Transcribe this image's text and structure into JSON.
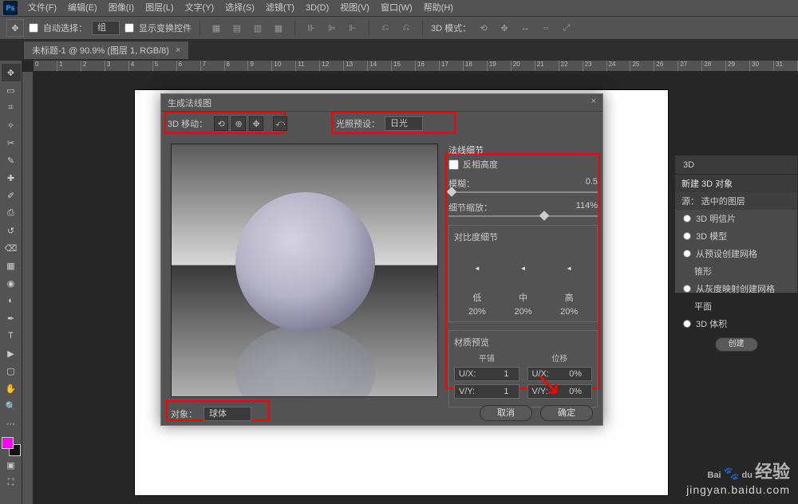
{
  "menubar": {
    "items": [
      "文件(F)",
      "编辑(E)",
      "图像(I)",
      "图层(L)",
      "文字(Y)",
      "选择(S)",
      "滤镜(T)",
      "3D(D)",
      "视图(V)",
      "窗口(W)",
      "帮助(H)"
    ]
  },
  "optbar": {
    "auto_select": "自动选择：",
    "auto_select_value": "组",
    "show_transform": "显示变换控件",
    "mode_3d": "3D 模式："
  },
  "tab": {
    "title": "未标题-1 @ 90.9% (图层 1, RGB/8)",
    "close": "×"
  },
  "ruler": {
    "marks": [
      "0",
      "1",
      "2",
      "3",
      "4",
      "5",
      "6",
      "7",
      "8",
      "9",
      "10",
      "11",
      "12",
      "13",
      "14",
      "15",
      "16",
      "17",
      "18",
      "19",
      "20",
      "21",
      "22",
      "23",
      "24",
      "25",
      "26",
      "27",
      "28",
      "29",
      "30",
      "31"
    ]
  },
  "dialog": {
    "title": "生成法线图",
    "close": "×",
    "move3d_label": "3D 移动：",
    "light_label": "光照预设：",
    "light_value": "日光",
    "normals_header": "法线细节",
    "invert_height": "反相高度",
    "blur_label": "模糊：",
    "blur_value": "0.5",
    "detail_scale_label": "细节缩放：",
    "detail_scale_value": "114%",
    "contrast_title": "对比度细节",
    "contrast_labels": {
      "low": "低",
      "mid": "中",
      "high": "高"
    },
    "contrast_values": {
      "low": "20%",
      "mid": "20%",
      "high": "20%"
    },
    "arrow_left": "◄",
    "arrow_right": "►",
    "mat_title": "材质预览",
    "mat_tile": "平铺",
    "mat_offset": "位移",
    "mat_ux": "U/X:",
    "mat_vy": "V/Y:",
    "mat_ux_tile": "1",
    "mat_vy_tile": "1",
    "mat_ux_off": "0%",
    "mat_vy_off": "0%",
    "object_label": "对象：",
    "object_value": "球体",
    "cancel": "取消",
    "ok": "确定"
  },
  "panel3d": {
    "tab": "3D",
    "new_obj": "新建 3D 对象",
    "source": "源：",
    "source_value": "选中的图层",
    "opts": [
      "3D 明信片",
      "3D 模型",
      "从预设创建网格",
      "锥形",
      "从灰度映射创建网格",
      "平面",
      "3D 体积"
    ],
    "create": "创建"
  },
  "watermark": {
    "brand": "Bai",
    "du": "du",
    "jy": "经验",
    "url": "jingyan.baidu.com"
  }
}
